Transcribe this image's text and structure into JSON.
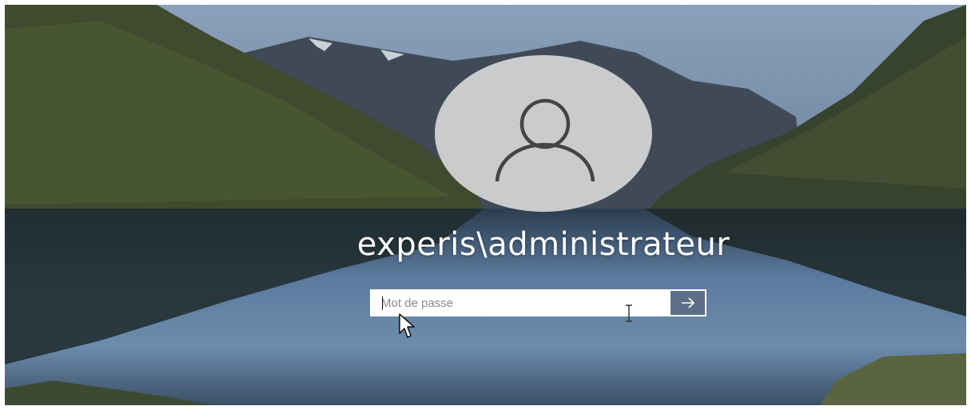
{
  "user": {
    "display_name": "experis\\administrateur",
    "avatar_icon": "user-silhouette-icon"
  },
  "password": {
    "placeholder": "Mot de passe",
    "value": "",
    "submit_icon": "arrow-right-icon"
  },
  "cursors": {
    "text_cursor": "ibeam-cursor-icon",
    "mouse_pointer": "mouse-pointer-icon"
  },
  "colors": {
    "submit_button": "#5d6f86",
    "avatar_circle": "#d6d6d6",
    "text": "#ffffff"
  }
}
